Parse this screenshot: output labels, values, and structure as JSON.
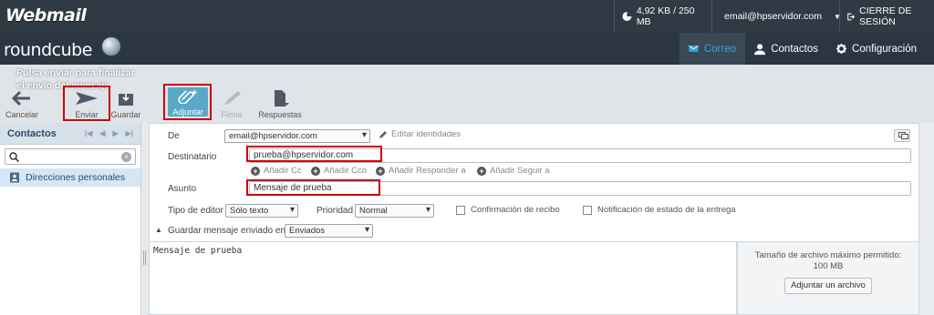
{
  "topbar": {
    "logo": "Webmail",
    "quota": "4,92 KB / 250 MB",
    "user": "email@hpservidor.com",
    "logout": "CIERRE DE SESIÓN"
  },
  "rcbar": {
    "logo": "roundcube",
    "nav": {
      "mail": "Correo",
      "contacts": "Contactos",
      "settings": "Configuración"
    },
    "active_color": "#37a7da"
  },
  "hint": "Pulsa enviar para finalizar el envío del mensaje",
  "toolbar": {
    "cancel": "Cancelar",
    "send": "Enviar",
    "save": "Guardar",
    "attach": "Adjuntar",
    "signature": "Firma",
    "responses": "Respuestas"
  },
  "sidebar": {
    "title": "Contactos",
    "item": "Direcciones personales"
  },
  "compose": {
    "from_label": "De",
    "from_value": "email@hpservidor.com",
    "edit_identities": "Editar identidades",
    "to_label": "Destinatario",
    "to_value": "prueba@hpservidor.com",
    "add_cc": "Añadir Cc",
    "add_bcc": "Añadir Cco",
    "add_reply_to": "Añadir Responder a",
    "add_followup": "Añadir Seguir a",
    "subject_label": "Asunto",
    "subject_value": "Mensaje de prueba",
    "editor_type_label": "Tipo de editor",
    "editor_type_value": "Sólo texto",
    "priority_label": "Prioridad",
    "priority_value": "Normal",
    "receipt_label": "Confirmación de recibo",
    "dsn_label": "Notificación de estado de la entrega",
    "save_sent_label": "Guardar mensaje enviado en",
    "save_sent_value": "Enviados",
    "body": "Mensaje de prueba"
  },
  "attachments": {
    "max_size_text": "Tamaño de archivo máximo permitido: 100 MB",
    "button": "Adjuntar un archivo"
  },
  "highlight_color": "#cc0000"
}
